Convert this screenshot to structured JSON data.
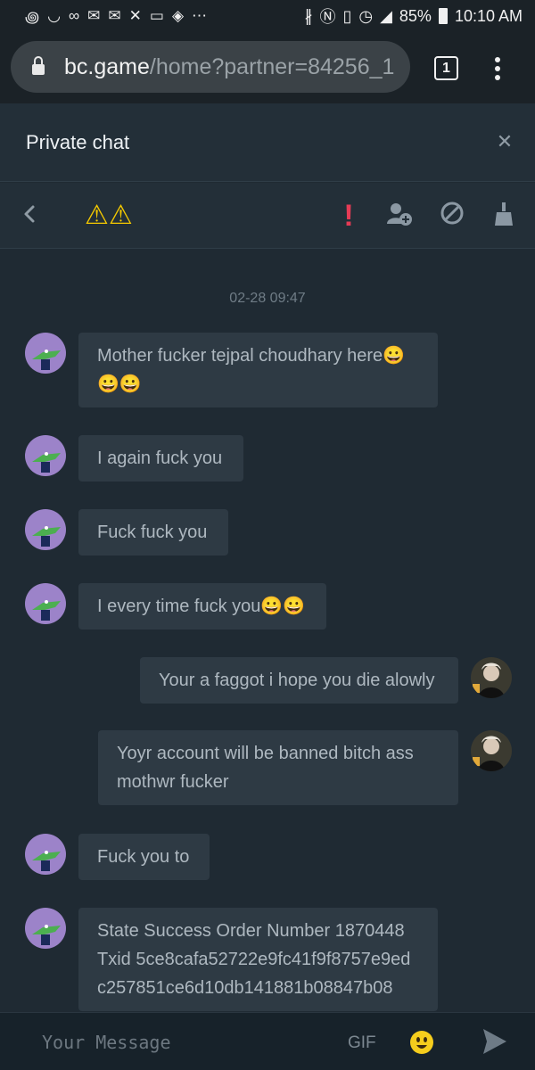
{
  "status_bar": {
    "battery": "85%",
    "time": "10:10 AM"
  },
  "browser": {
    "url_domain": "bc.game",
    "url_path": "/home?partner=84256_1",
    "tab_count": "1"
  },
  "chat": {
    "title": "Private chat",
    "close_icon": "close-icon",
    "peer_name": "⚠⚠",
    "toolbar_icons": [
      "report-icon",
      "add-friend-icon",
      "block-icon",
      "clear-icon"
    ],
    "timestamp": "02-28 09:47"
  },
  "messages": [
    {
      "side": "left",
      "text": "Mother fucker tejpal choudhary here😀😀😀"
    },
    {
      "side": "left",
      "text": "I again fuck you"
    },
    {
      "side": "left",
      "text": "Fuck fuck you"
    },
    {
      "side": "left",
      "text": "I every time fuck you😀😀"
    },
    {
      "side": "right",
      "text": "Your a faggot i hope you die alowly"
    },
    {
      "side": "right",
      "text": "Yoyr account will be banned bitch ass mothwr fucker"
    },
    {
      "side": "left",
      "text": "Fuck you to"
    },
    {
      "side": "left",
      "text": "State Success Order Number 1870448 Txid 5ce8cafa52722e9fc41f9f8757e9edc257851ce6d10db141881b08847b08"
    }
  ],
  "footer": {
    "placeholder": "Your Message",
    "gif_label": "GIF"
  },
  "colors": {
    "background": "#1f2a33",
    "bubble": "#2e3a44",
    "warning": "#f4c900",
    "report": "#e63b55"
  }
}
